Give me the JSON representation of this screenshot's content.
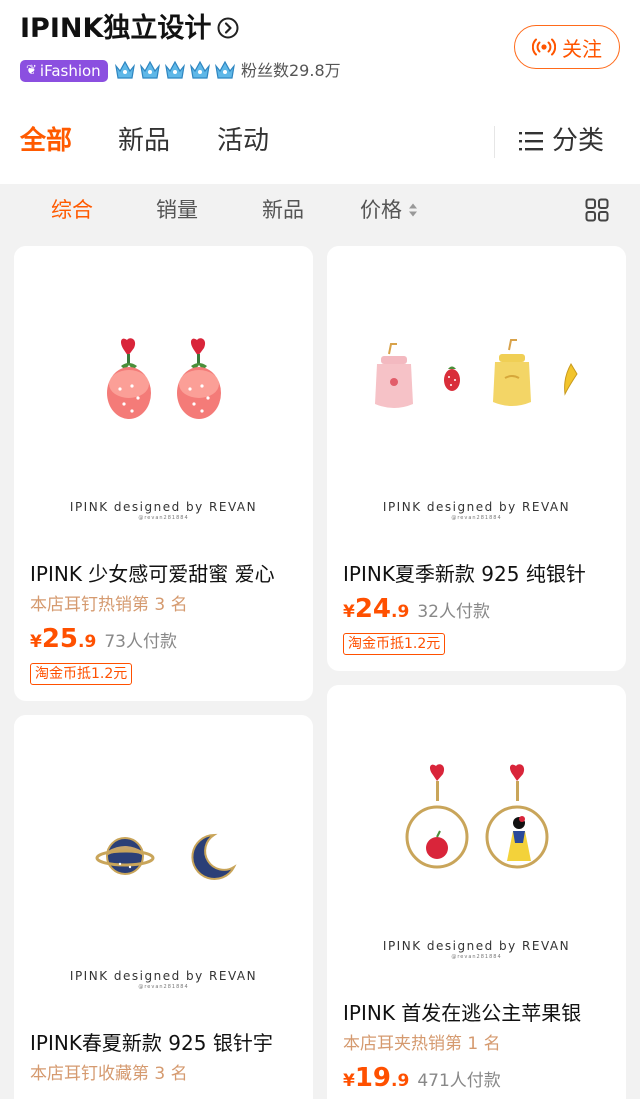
{
  "shop": {
    "name": "IPINK独立设计",
    "badge": "iFashion",
    "fans_label": "粉丝数29.8万",
    "follow_label": "关注",
    "crown_count": 5,
    "accent": "#ff5000",
    "badge_color": "#8b4fe0"
  },
  "tabs": [
    {
      "label": "全部",
      "active": true
    },
    {
      "label": "新品",
      "active": false
    },
    {
      "label": "活动",
      "active": false
    }
  ],
  "category_label": "分类",
  "sort": [
    {
      "label": "综合",
      "active": true
    },
    {
      "label": "销量",
      "active": false
    },
    {
      "label": "新品",
      "active": false
    },
    {
      "label": "价格",
      "active": false
    }
  ],
  "products": [
    {
      "brand": "IPINK designed by REVAN",
      "brand_sub": "@revan281884",
      "title": "IPINK 少女感可爱甜蜜 爱心",
      "rank": "本店耳钉热销第 3 名",
      "yen": "¥",
      "price_int": "25",
      "price_dec": ".9",
      "sales": "73人付款",
      "coin": "淘金币抵1.2元",
      "image": "strawberry-heart-earrings"
    },
    {
      "brand": "IPINK designed by REVAN",
      "brand_sub": "@revan281884",
      "title": "IPINK夏季新款 925 纯银针",
      "rank": "",
      "yen": "¥",
      "price_int": "24",
      "price_dec": ".9",
      "sales": "32人付款",
      "coin": "淘金币抵1.2元",
      "image": "milk-bottle-fruit-earrings"
    },
    {
      "brand": "IPINK designed by REVAN",
      "brand_sub": "@revan281884",
      "title": "IPINK春夏新款 925 银针宇",
      "rank": "本店耳钉收藏第 3 名",
      "yen": "¥",
      "price_int": "",
      "price_dec": "",
      "sales": "",
      "coin": "",
      "image": "planet-moon-earrings"
    },
    {
      "brand": "IPINK designed by REVAN",
      "brand_sub": "@revan281884",
      "title": "IPINK 首发在逃公主苹果银",
      "rank": "本店耳夹热销第 1 名",
      "yen": "¥",
      "price_int": "19",
      "price_dec": ".9",
      "sales": "471人付款",
      "coin": "",
      "image": "apple-princess-hoop-earrings"
    }
  ]
}
